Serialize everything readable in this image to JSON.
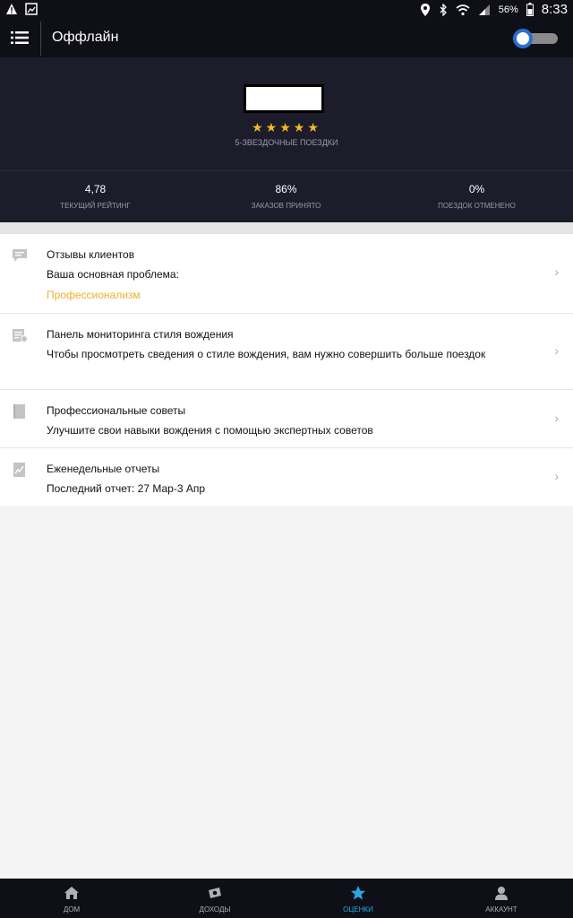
{
  "status_bar": {
    "battery": "56%",
    "time": "8:33"
  },
  "app_bar": {
    "title": "Оффлайн"
  },
  "hero": {
    "stars": "★★★★★",
    "five_star_label": "5-ЗВЕЗДОЧНЫЕ ПОЕЗДКИ",
    "stats": [
      {
        "value": "4,78",
        "label": "ТЕКУЩИЙ РЕЙТИНГ"
      },
      {
        "value": "86%",
        "label": "ЗАКАЗОВ ПРИНЯТО"
      },
      {
        "value": "0%",
        "label": "ПОЕЗДОК ОТМЕНЕНО"
      }
    ]
  },
  "items": [
    {
      "icon": "chat-bubble-icon",
      "title": "Отзывы клиентов",
      "sub": "Ваша основная проблема:",
      "highlight": "Профессионализм"
    },
    {
      "icon": "dashboard-icon",
      "title": "Панель мониторинга стиля вождения",
      "sub": "Чтобы просмотреть сведения о стиле вождения, вам нужно совершить больше поездок"
    },
    {
      "icon": "book-icon",
      "title": "Профессиональные советы",
      "sub": "Улучшите свои навыки вождения с помощью экспертных советов"
    },
    {
      "icon": "report-chart-icon",
      "title": "Еженедельные отчеты",
      "sub": "Последний отчет: 27 Мар-3 Апр"
    }
  ],
  "chevron": "›",
  "tabs": [
    {
      "icon": "home-icon",
      "label": "ДОМ"
    },
    {
      "icon": "money-icon",
      "label": "ДОХОДЫ"
    },
    {
      "icon": "star-icon",
      "label": "ОЦЕНКИ",
      "active": true
    },
    {
      "icon": "person-icon",
      "label": "АККАУНТ"
    }
  ],
  "colors": {
    "accent_orange": "#f0b02a",
    "active_tab": "#29a8e0",
    "star": "#f5b91e",
    "toggle": "#2a6ed1",
    "bar_bg": "#0f0f18",
    "hero_bg": "#1c1c2b"
  }
}
